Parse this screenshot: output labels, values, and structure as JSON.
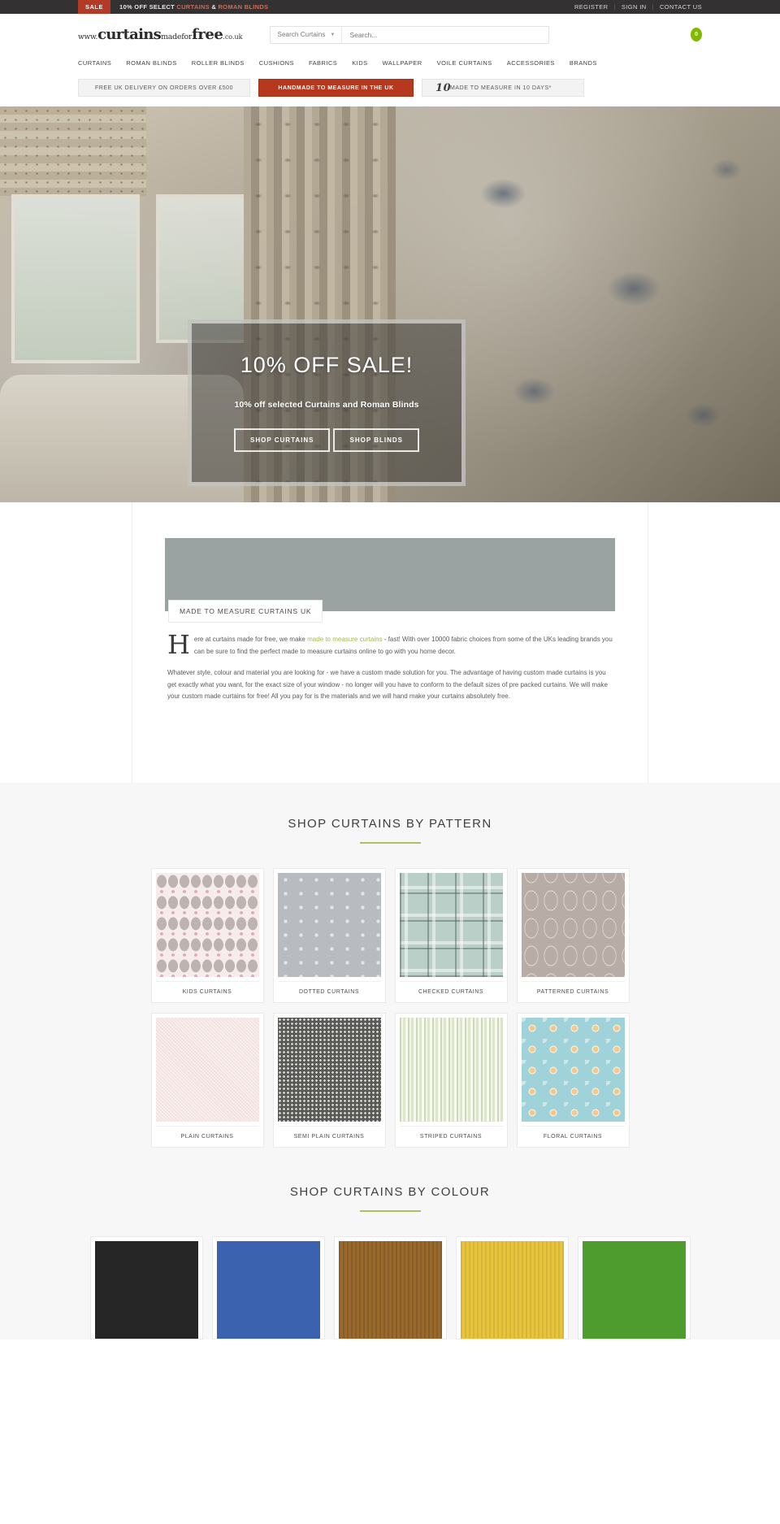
{
  "topbar": {
    "sale_badge": "SALE",
    "promo_prefix": "10% OFF SELECT",
    "promo_link1": "CURTAINS",
    "promo_amp": "&",
    "promo_link2": "ROMAN BLINDS",
    "links": [
      "REGISTER",
      "SIGN IN",
      "CONTACT US"
    ],
    "separator": "|"
  },
  "header": {
    "logo": {
      "www": "www.",
      "word1": "curtains",
      "mid": "madefor",
      "word2": "free",
      "domain": ".co.uk"
    },
    "search": {
      "category_label": "Search Curtains",
      "placeholder": "Search...",
      "value": ""
    },
    "cart_count": "0"
  },
  "nav": {
    "items": [
      "CURTAINS",
      "ROMAN BLINDS",
      "ROLLER BLINDS",
      "CUSHIONS",
      "FABRICS",
      "KIDS",
      "WALLPAPER",
      "VOILE CURTAINS",
      "ACCESSORIES",
      "BRANDS"
    ]
  },
  "promos": [
    {
      "label": "FREE UK DELIVERY ON ORDERS OVER £500",
      "style": "plain"
    },
    {
      "label": "HANDMADE TO MEASURE IN THE UK",
      "style": "red"
    },
    {
      "label": "MADE TO MEASURE IN 10 DAYS*",
      "style": "days",
      "number": "10"
    }
  ],
  "hero": {
    "heading": "10% OFF SALE!",
    "subheading": "10% off selected Curtains and Roman Blinds",
    "buttons": [
      "SHOP CURTAINS",
      "SHOP BLINDS"
    ]
  },
  "intro": {
    "tag": "MADE TO MEASURE CURTAINS UK",
    "dropcap": "H",
    "paragraph1_a": "ere at curtains made for free, we make ",
    "paragraph1_link": "made to measure curtains",
    "paragraph1_b": " - fast! With over 10000 fabric choices from some of the UKs leading brands you can be sure to find the perfect made to measure curtains online to go with you home decor.",
    "paragraph2": "Whatever style, colour and material you are looking for - we have a custom made solution for you. The advantage of having custom made curtains is you get exactly what you want, for the exact size of your window - no longer will you have to conform to the default sizes of pre packed curtains. We will make your custom made curtains for free! All you pay for is the materials and we will hand make your curtains absolutely free."
  },
  "pattern_section": {
    "title": "SHOP CURTAINS BY PATTERN",
    "row1": [
      {
        "label": "KIDS CURTAINS",
        "swatch": "sw-kids"
      },
      {
        "label": "DOTTED CURTAINS",
        "swatch": "sw-dotted"
      },
      {
        "label": "CHECKED CURTAINS",
        "swatch": "sw-checked"
      },
      {
        "label": "PATTERNED CURTAINS",
        "swatch": "sw-patterned"
      }
    ],
    "row2": [
      {
        "label": "PLAIN CURTAINS",
        "swatch": "sw-plain"
      },
      {
        "label": "SEMI PLAIN CURTAINS",
        "swatch": "sw-semiplain"
      },
      {
        "label": "STRIPED CURTAINS",
        "swatch": "sw-striped"
      },
      {
        "label": "FLORAL CURTAINS",
        "swatch": "sw-floral"
      }
    ]
  },
  "colour_section": {
    "title": "SHOP CURTAINS BY COLOUR",
    "swatches": [
      {
        "name": "black",
        "class": "c-black",
        "color": "#262626"
      },
      {
        "name": "blue",
        "class": "c-blue",
        "color": "#3b62ae"
      },
      {
        "name": "brown",
        "class": "c-brown",
        "color": "#9a6a2c"
      },
      {
        "name": "yellow",
        "class": "c-yellow",
        "color": "#e8c43c"
      },
      {
        "name": "green",
        "class": "c-green",
        "color": "#4f9c2e"
      }
    ]
  },
  "theme": {
    "topbar_bg": "#333131",
    "sale_red": "#b33a26",
    "accent_green": "#b2bd5e",
    "cart_green": "#7fb900",
    "promo_red": "#b5381f"
  }
}
